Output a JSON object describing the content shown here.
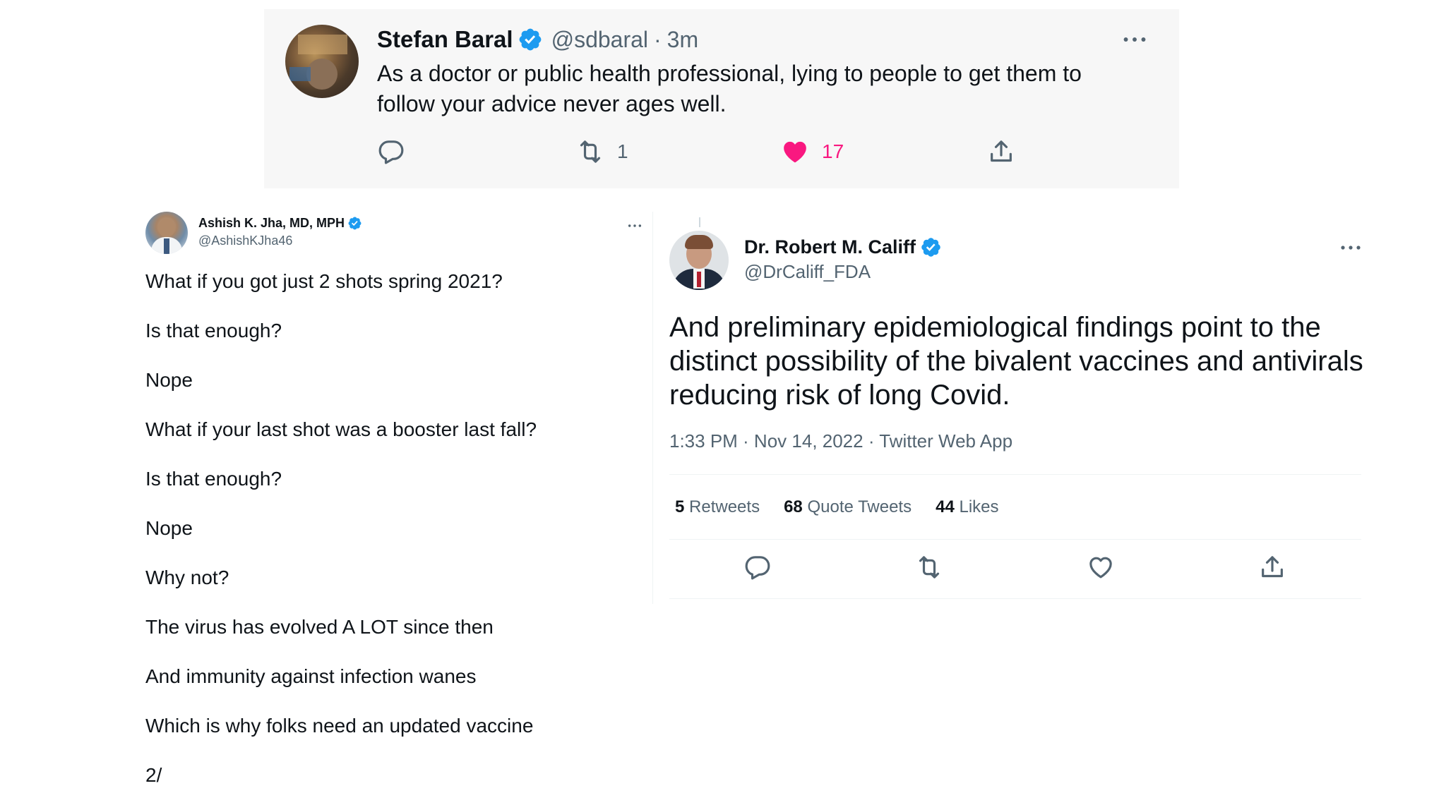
{
  "top_tweet": {
    "name": "Stefan Baral",
    "handle": "@sdbaral",
    "separator": "·",
    "time": "3m",
    "text": "As a doctor or public health professional, lying to people to get them to follow your advice never ages well.",
    "retweets": "1",
    "likes": "17",
    "like_color": "#f91880"
  },
  "left_tweet": {
    "name": "Ashish K. Jha, MD, MPH",
    "handle": "@AshishKJha46",
    "lines": [
      "What if you got just 2 shots spring 2021?",
      "Is that enough?",
      "Nope",
      "What if your last shot was a booster last fall?",
      "Is that enough?",
      "Nope",
      "Why not?",
      "The virus has evolved A LOT since then",
      "And immunity against infection wanes",
      "Which is why folks need an updated vaccine",
      "2/"
    ]
  },
  "right_tweet": {
    "name": "Dr. Robert M. Califf",
    "handle": "@DrCaliff_FDA",
    "text": "And preliminary epidemiological findings point to the distinct possibility of the bivalent vaccines and antivirals reducing risk of long Covid.",
    "meta": "1:33 PM · Nov 14, 2022 · Twitter Web App",
    "stats": [
      {
        "num": "5",
        "label": "Retweets"
      },
      {
        "num": "68",
        "label": "Quote Tweets"
      },
      {
        "num": "44",
        "label": "Likes"
      }
    ]
  },
  "colors": {
    "verified": "#1d9bf0",
    "secondary_text": "#536471",
    "card_background": "#f7f7f7"
  },
  "icons": [
    "verified-badge-icon",
    "more-icon",
    "reply-icon",
    "retweet-icon",
    "heart-icon",
    "share-icon"
  ]
}
